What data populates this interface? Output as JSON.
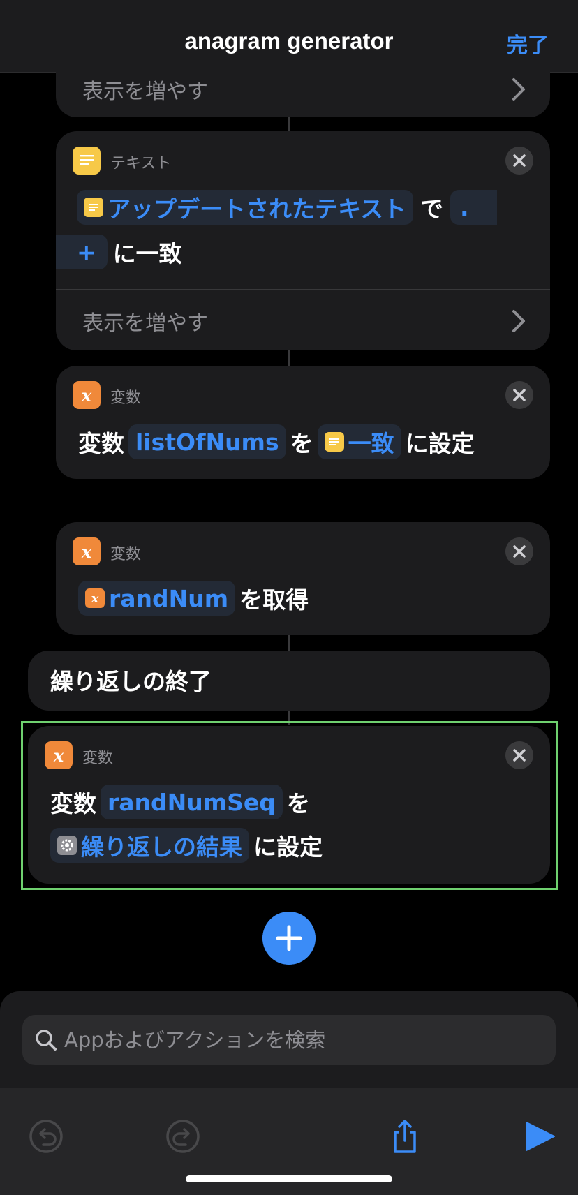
{
  "header": {
    "title": "anagram generator",
    "done_label": "完了"
  },
  "show_more_label": "表示を増やす",
  "text_action": {
    "header": "テキスト",
    "token_text": "アップデートされたテキスト",
    "connector_de": "で",
    "token_period": ".",
    "token_plus": "+",
    "match_text": "に一致"
  },
  "set_list_var": {
    "header": "変数",
    "prefix": "変数",
    "var_name": "listOfNums",
    "wo": "を",
    "source_token": "一致",
    "suffix": "に設定"
  },
  "get_var": {
    "header": "変数",
    "var_name": "randNum",
    "suffix": "を取得"
  },
  "end_repeat": {
    "label": "繰り返しの終了"
  },
  "set_seq_var": {
    "header": "変数",
    "prefix": "変数",
    "var_name": "randNumSeq",
    "wo": "を",
    "source_token": "繰り返しの結果",
    "suffix": "に設定"
  },
  "search": {
    "placeholder": "Appおよびアクションを検索"
  },
  "colors": {
    "accent": "#3b8cf7",
    "highlight": "#6fd06f",
    "text_icon": "#f7c948",
    "var_icon": "#f0893a"
  }
}
